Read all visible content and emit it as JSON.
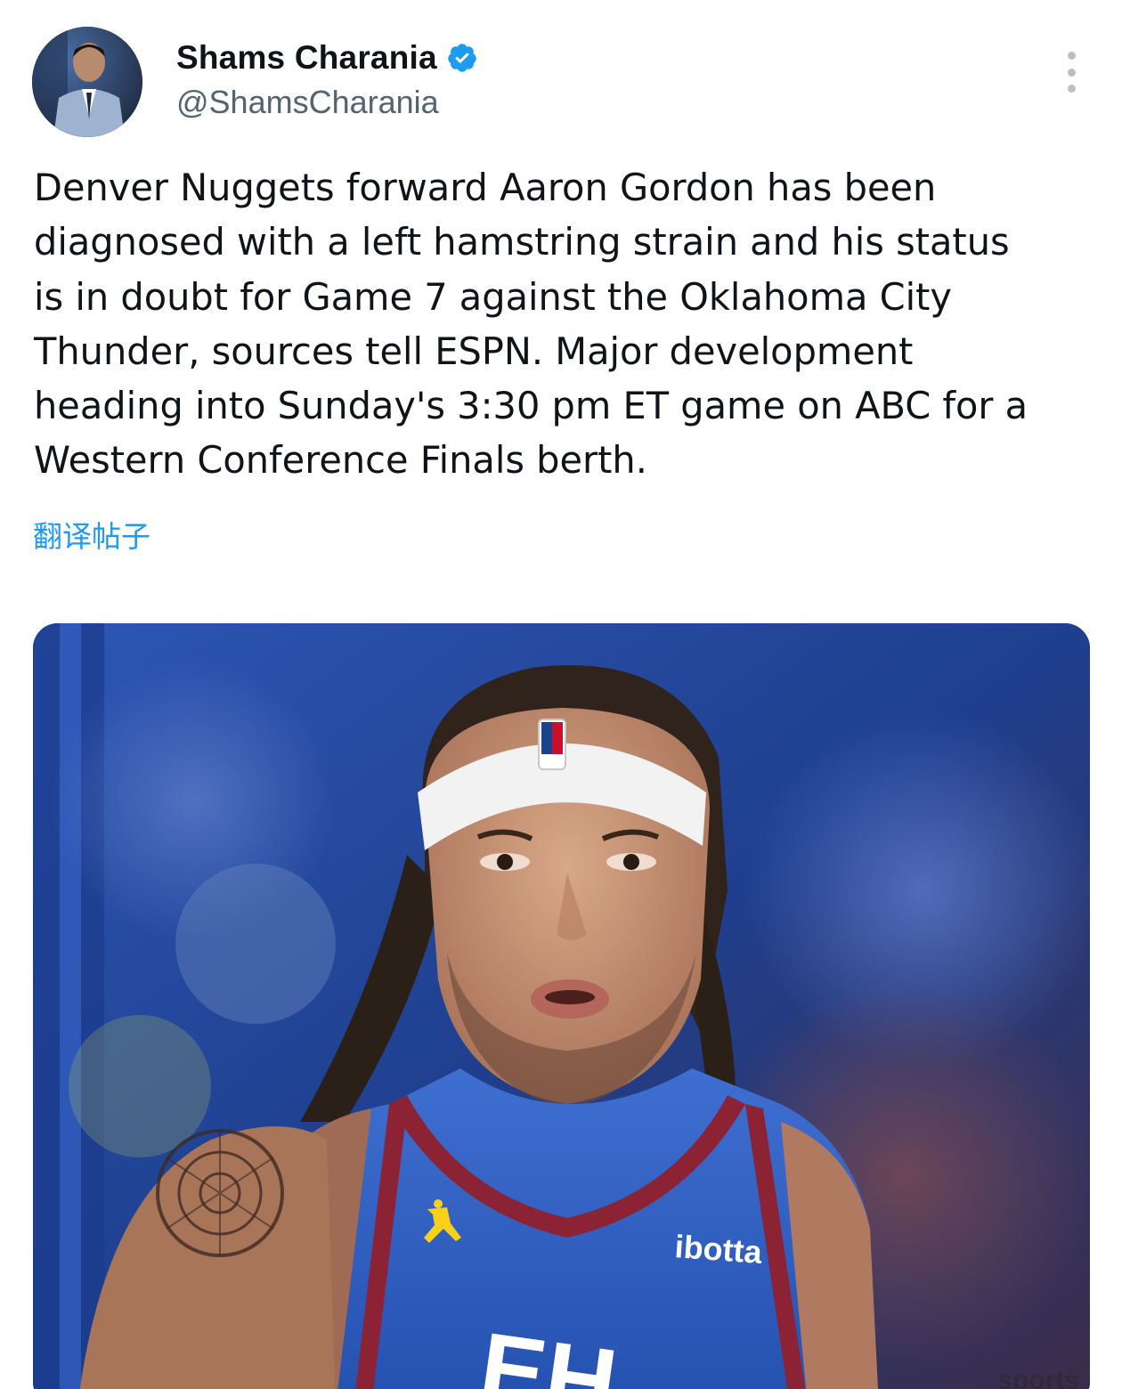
{
  "author": {
    "display_name": "Shams Charania",
    "handle": "@ShamsCharania",
    "verified": true
  },
  "icons": {
    "verified": "verified-badge-icon",
    "more": "more-options-icon"
  },
  "tweet": {
    "text": "Denver Nuggets forward Aaron Gordon has been\ndiagnosed with a left hamstring strain and his status\nis in doubt for Game 7 against the Oklahoma City\nThunder, sources tell ESPN. Major development\nheading into Sunday's 3:30 pm ET game on ABC for a\nWestern Conference Finals berth.",
    "translate_label": "翻译帖子"
  },
  "media": {
    "jersey_sponsor": "ibotta",
    "jersey_partial_text": "EH"
  },
  "watermark": "sports",
  "colors": {
    "link": "#1d9bf0",
    "verified": "#1d9bf0",
    "secondary_text": "#536471"
  }
}
